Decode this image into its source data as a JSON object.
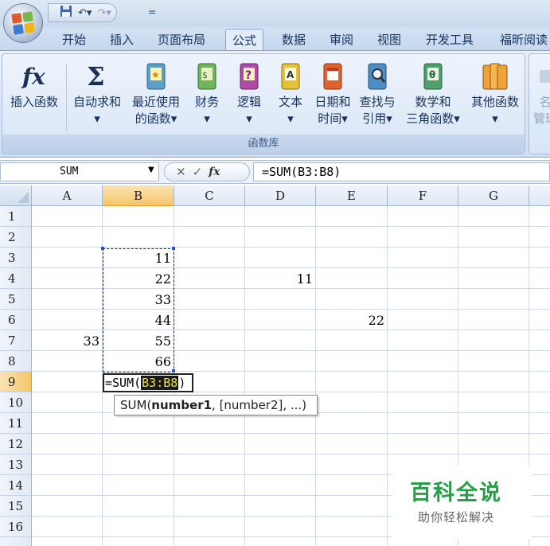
{
  "app": {
    "ribbon_tabs": [
      {
        "label": "开始"
      },
      {
        "label": "插入"
      },
      {
        "label": "页面布局"
      },
      {
        "label": "公式"
      },
      {
        "label": "数据"
      },
      {
        "label": "审阅"
      },
      {
        "label": "视图"
      },
      {
        "label": "开发工具"
      },
      {
        "label": "福昕阅读"
      }
    ],
    "qat_suffix": "="
  },
  "ribbon": {
    "group_label": "函数库",
    "buttons": [
      {
        "icon": "insert-function-icon",
        "label": "插入函数",
        "sub": ""
      },
      {
        "icon": "autosum-icon",
        "label": "自动求和",
        "sub": "▾"
      },
      {
        "icon": "recent-functions-book-icon",
        "label": "最近使用",
        "sub": "的函数▾"
      },
      {
        "icon": "financial-book-icon",
        "label": "财务",
        "sub": "▾"
      },
      {
        "icon": "logical-book-icon",
        "label": "逻辑",
        "sub": "▾"
      },
      {
        "icon": "text-book-icon",
        "label": "文本",
        "sub": "▾"
      },
      {
        "icon": "datetime-book-icon",
        "label": "日期和",
        "sub": "时间▾"
      },
      {
        "icon": "lookup-book-icon",
        "label": "查找与",
        "sub": "引用▾"
      },
      {
        "icon": "math-book-icon",
        "label": "数学和",
        "sub": "三角函数▾"
      },
      {
        "icon": "more-functions-book-icon",
        "label": "其他函数",
        "sub": "▾"
      }
    ],
    "partial_label_1": "名",
    "partial_label_2": "管理"
  },
  "formula_bar": {
    "name_box": "SUM",
    "content": "=SUM(B3:B8)",
    "fx": "fx"
  },
  "sheet": {
    "columns": [
      "A",
      "B",
      "C",
      "D",
      "E",
      "F",
      "G"
    ],
    "rows": [
      "1",
      "2",
      "3",
      "4",
      "5",
      "6",
      "7",
      "8",
      "9",
      "10",
      "11",
      "12",
      "13",
      "14",
      "15",
      "16"
    ],
    "selected_column": "B",
    "selected_row": "9",
    "cells": [
      {
        "ref": "B3",
        "value": "11"
      },
      {
        "ref": "B4",
        "value": "22"
      },
      {
        "ref": "D4",
        "value": "11"
      },
      {
        "ref": "B5",
        "value": "33"
      },
      {
        "ref": "B6",
        "value": "44"
      },
      {
        "ref": "E6",
        "value": "22"
      },
      {
        "ref": "A7",
        "value": "33"
      },
      {
        "ref": "B7",
        "value": "55"
      },
      {
        "ref": "B8",
        "value": "66"
      }
    ],
    "edit_cell": {
      "prefix": "=SUM(",
      "ref": "B3:B8",
      "suffix": ")"
    },
    "tooltip": {
      "fn": "SUM(",
      "arg1": "number1",
      "rest": ", [number2], ...)"
    }
  },
  "watermark": {
    "title": "百科全说",
    "subtitle": "助你轻松解决"
  }
}
